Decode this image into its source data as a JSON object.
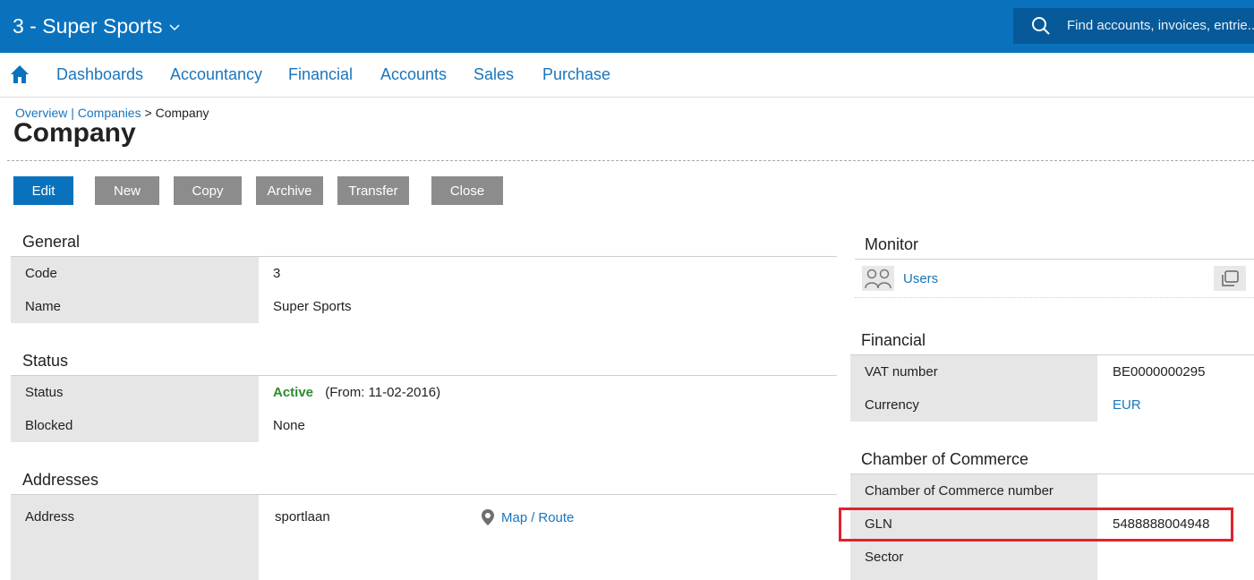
{
  "header": {
    "company": "3 - Super Sports",
    "search_placeholder": "Find accounts, invoices, entrie..."
  },
  "nav": {
    "items": [
      "Dashboards",
      "Accountancy",
      "Financial",
      "Accounts",
      "Sales",
      "Purchase"
    ]
  },
  "breadcrumb": {
    "overview": "Overview",
    "sep": "|",
    "companies": "Companies",
    "arrow": ">",
    "current": "Company"
  },
  "page": {
    "title": "Company"
  },
  "toolbar": {
    "edit": "Edit",
    "new": "New",
    "copy": "Copy",
    "archive": "Archive",
    "transfer": "Transfer",
    "close": "Close"
  },
  "general": {
    "title": "General",
    "code_label": "Code",
    "code_value": "3",
    "name_label": "Name",
    "name_value": "Super Sports"
  },
  "status": {
    "title": "Status",
    "status_label": "Status",
    "status_value": "Active",
    "status_from": "(From: 11-02-2016)",
    "blocked_label": "Blocked",
    "blocked_value": "None"
  },
  "addresses": {
    "title": "Addresses",
    "address_label": "Address",
    "address_value": "sportlaan",
    "map": "Map",
    "slash": "/",
    "route": "Route"
  },
  "monitor": {
    "title": "Monitor",
    "users": "Users"
  },
  "financial": {
    "title": "Financial",
    "vat_label": "VAT number",
    "vat_value": "BE0000000295",
    "currency_label": "Currency",
    "currency_value": "EUR"
  },
  "chamber": {
    "title": "Chamber of Commerce",
    "coc_label": "Chamber of Commerce number",
    "coc_value": "",
    "gln_label": "GLN",
    "gln_value": "5488888004948",
    "sector_label": "Sector",
    "sector_value": ""
  },
  "colors": {
    "brand": "#0a72bd",
    "link": "#1b75bb",
    "active": "#2d8a2d",
    "highlight": "#e0222b"
  }
}
